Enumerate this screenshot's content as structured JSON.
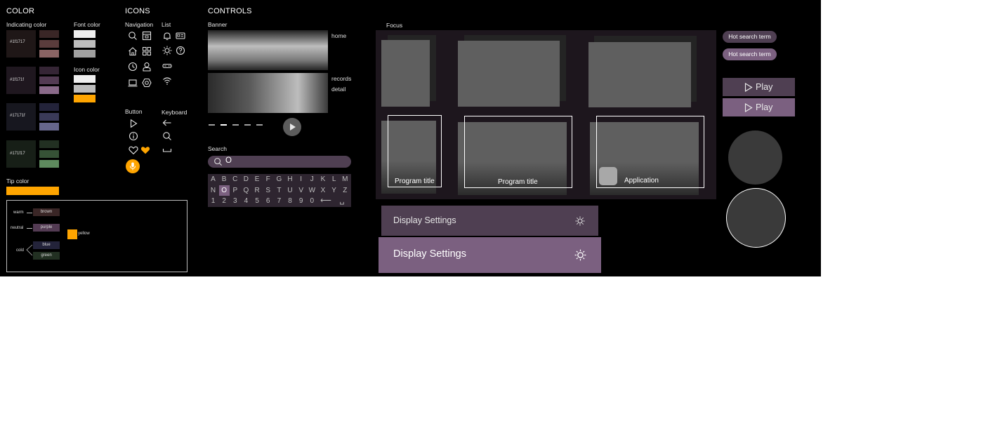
{
  "sections": {
    "color": "COLOR",
    "icons": "ICONS",
    "controls": "CONTROLS"
  },
  "color": {
    "indicating_title": "Indicating color",
    "indicating": [
      {
        "label": "#1f1717",
        "main": "#1f1717",
        "shades": [
          "#3a2626",
          "#5a3c3c",
          "#8a6464"
        ]
      },
      {
        "label": "#1f171f",
        "main": "#1f171f",
        "shades": [
          "#352535",
          "#533b53",
          "#8a6a8a"
        ]
      },
      {
        "label": "#17171f",
        "main": "#17171f",
        "shades": [
          "#23233a",
          "#3a3a58",
          "#66668c"
        ]
      },
      {
        "label": "#171f17",
        "main": "#171f17",
        "shades": [
          "#223022",
          "#365236",
          "#5e8a5e"
        ]
      }
    ],
    "font_title": "Font color",
    "font_colors": [
      "#efefef",
      "#bdbdbd",
      "#a0a0a0"
    ],
    "icon_title": "Icon color",
    "icon_colors": [
      "#efefef",
      "#bdbdbd",
      "#ffa500"
    ],
    "tip_title": "Tip color",
    "tip_color": "#ffa500",
    "legend": {
      "warm": "warm",
      "neutral": "neutral",
      "cold": "cold",
      "brown": "brown",
      "purple": "purple",
      "blue": "blue",
      "green": "green",
      "yellow": "yellow",
      "brown_color": "#3a2626",
      "purple_color": "#533b53",
      "blue_color": "#23233a",
      "green_color": "#223022",
      "yellow_color": "#ffa500"
    }
  },
  "icons": {
    "navigation_title": "Navigation",
    "list_title": "List",
    "button_title": "Button",
    "keyboard_title": "Keyboard",
    "navigation": [
      "search-icon",
      "store-icon",
      "home-icon",
      "apps-grid-icon",
      "history-clock-icon",
      "user-icon",
      "laptop-icon",
      "hexagon-settings-icon"
    ],
    "list": [
      "bell-icon",
      "id-card-icon",
      "brightness-icon",
      "help-icon",
      "gamepad-icon",
      "wifi-icon"
    ],
    "buttons": [
      "play-icon",
      "info-icon",
      "heart-outline-icon",
      "heart-filled-icon",
      "microphone-icon"
    ],
    "keyboard": [
      "backspace-arrow-icon",
      "search-icon",
      "space-icon"
    ],
    "accent": "#ffa500"
  },
  "controls": {
    "banner_title": "Banner",
    "banner_home": "home",
    "banner_records": "records",
    "banner_detail": "detail",
    "search_title": "Search",
    "search_value": "O",
    "keyboard_rows": [
      [
        "A",
        "B",
        "C",
        "D",
        "E",
        "F",
        "G",
        "H",
        "I",
        "J",
        "K",
        "L",
        "M"
      ],
      [
        "N",
        "O",
        "P",
        "Q",
        "R",
        "S",
        "T",
        "U",
        "V",
        "W",
        "X",
        "Y",
        "Z"
      ],
      [
        "1",
        "2",
        "3",
        "4",
        "5",
        "6",
        "7",
        "8",
        "9",
        "0",
        "⟵",
        "␣"
      ]
    ],
    "keyboard_selected": "O",
    "focus_title": "Focus",
    "program_title_1": "Program title",
    "program_title_2": "Program title",
    "application": "Application",
    "hot_search_1": "Hot search term",
    "hot_search_2": "Hot search term",
    "play_1": "Play",
    "play_2": "Play",
    "display_settings_1": "Display Settings",
    "display_settings_2": "Display Settings",
    "purple": "#7b6080",
    "dark_purple": "#4f3f52",
    "focus_bg": "#1d161d"
  }
}
